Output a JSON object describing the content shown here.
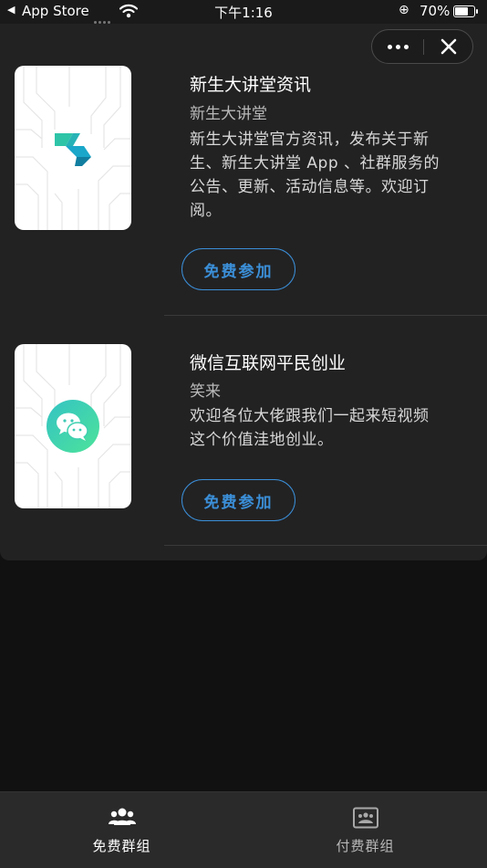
{
  "status_bar": {
    "back_app": "App Store",
    "time": "下午1:16",
    "battery": "70%"
  },
  "capsule": {
    "more_icon": "more-dots-icon",
    "close_icon": "close-icon"
  },
  "groups": [
    {
      "title": "新生大讲堂资讯",
      "subtitle": "新生大讲堂",
      "desc_lines": [
        "新生大讲堂官方资讯，发布关于新",
        "生、新生大讲堂 App 、社群服务的",
        "公告、更新、活动信息等。欢迎订",
        "阅。"
      ],
      "button": "免费参加",
      "icon": "xinsheng-logo-icon"
    },
    {
      "title": "微信互联网平民创业",
      "subtitle": "笑来",
      "desc_lines": [
        "欢迎各位大佬跟我们一起来短视频",
        "这个价值洼地创业。"
      ],
      "button": "免费参加",
      "icon": "wechat-icon"
    }
  ],
  "tabs": [
    {
      "label": "免费群组",
      "icon": "people-icon",
      "active": true
    },
    {
      "label": "付费群组",
      "icon": "paid-group-icon",
      "active": false
    }
  ],
  "colors": {
    "accent": "#3b8fd8",
    "panel": "#222223",
    "background": "#111111",
    "wechat": "#3fd6a8"
  }
}
